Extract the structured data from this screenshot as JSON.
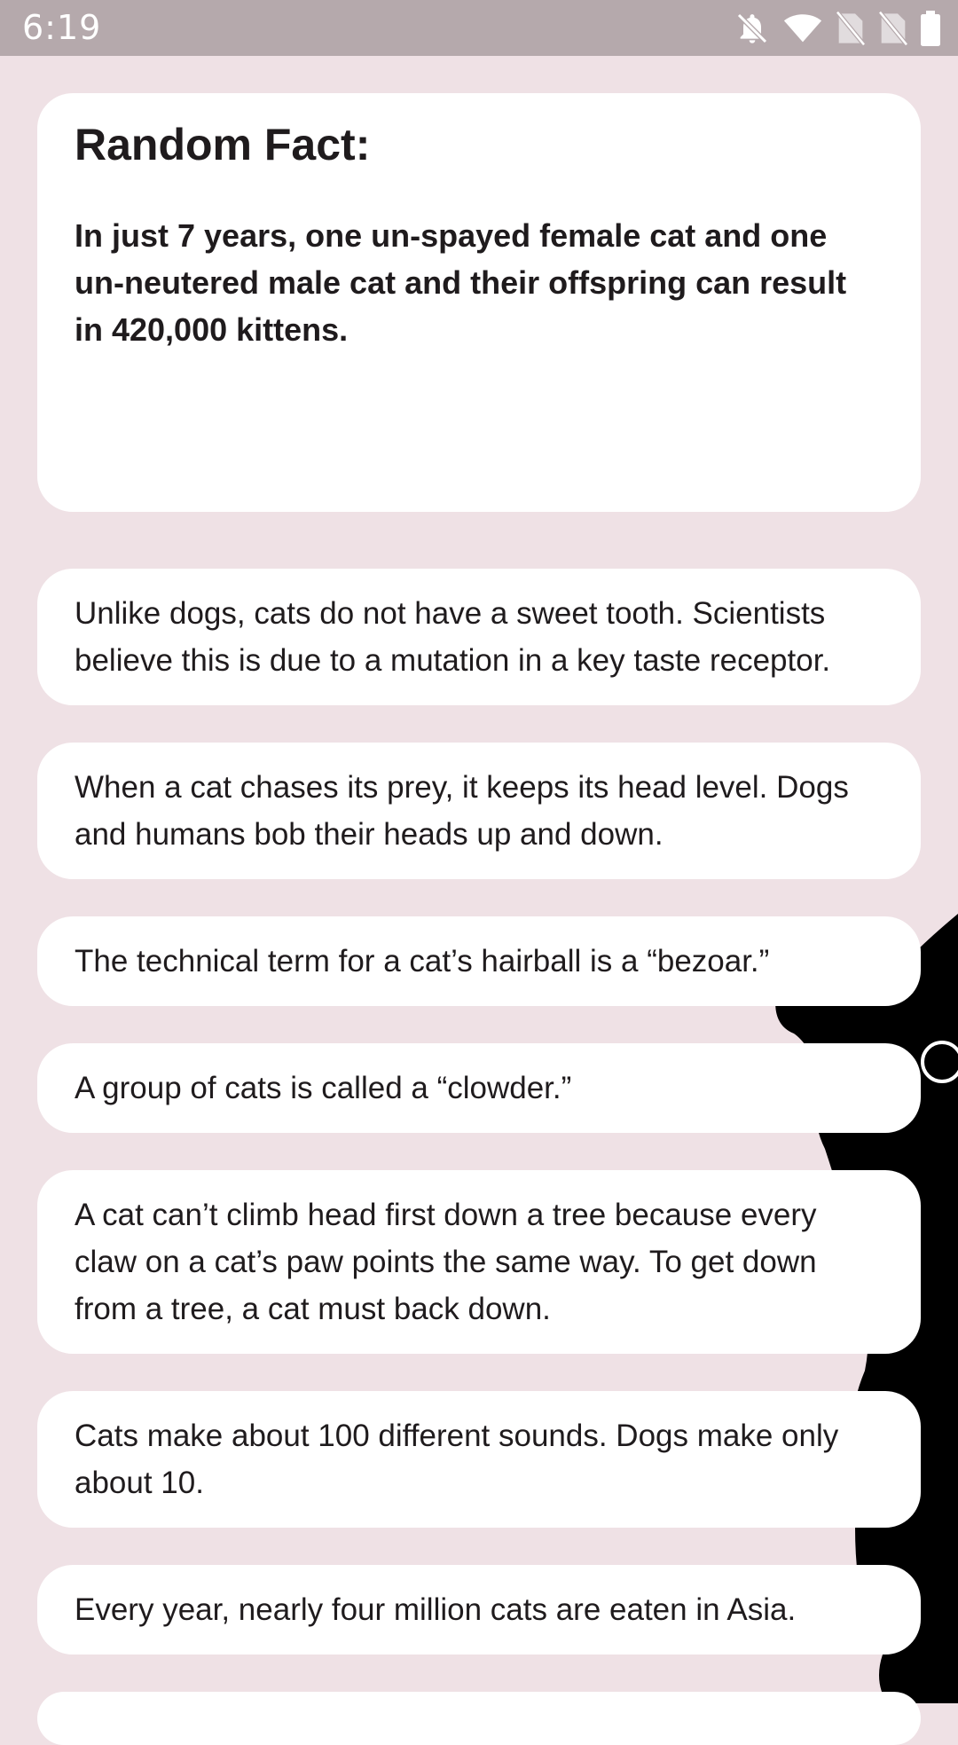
{
  "status_bar": {
    "time": "6:19",
    "icons": [
      "bell-off-icon",
      "wifi-icon",
      "sim-no-signal-icon",
      "sim-no-signal-icon",
      "battery-full-icon"
    ]
  },
  "hero": {
    "title": "Random Fact:",
    "text": "In just 7 years, one un-spayed female cat and one un-neutered male cat and their offspring can result in 420,000 kittens."
  },
  "facts": [
    "Unlike dogs, cats do not have a sweet tooth. Scientists believe this is due to a mutation in a key taste receptor.",
    "When a cat chases its prey, it keeps its head level. Dogs and humans bob their heads up and down.",
    "The technical term for a cat’s hairball is a “bezoar.”",
    "A group of cats is called a “clowder.”",
    "A cat can’t climb head first down a tree because every claw on a cat’s paw points the same way. To get down from a tree, a cat must back down.",
    "Cats make about 100 different sounds. Dogs make only about 10.",
    "Every year, nearly four million cats are eaten in Asia."
  ],
  "colors": {
    "background": "#efe1e5",
    "status_bar": "#b5a9ac",
    "card": "#ffffff",
    "text": "#1f1b1d",
    "cat": "#000000"
  }
}
